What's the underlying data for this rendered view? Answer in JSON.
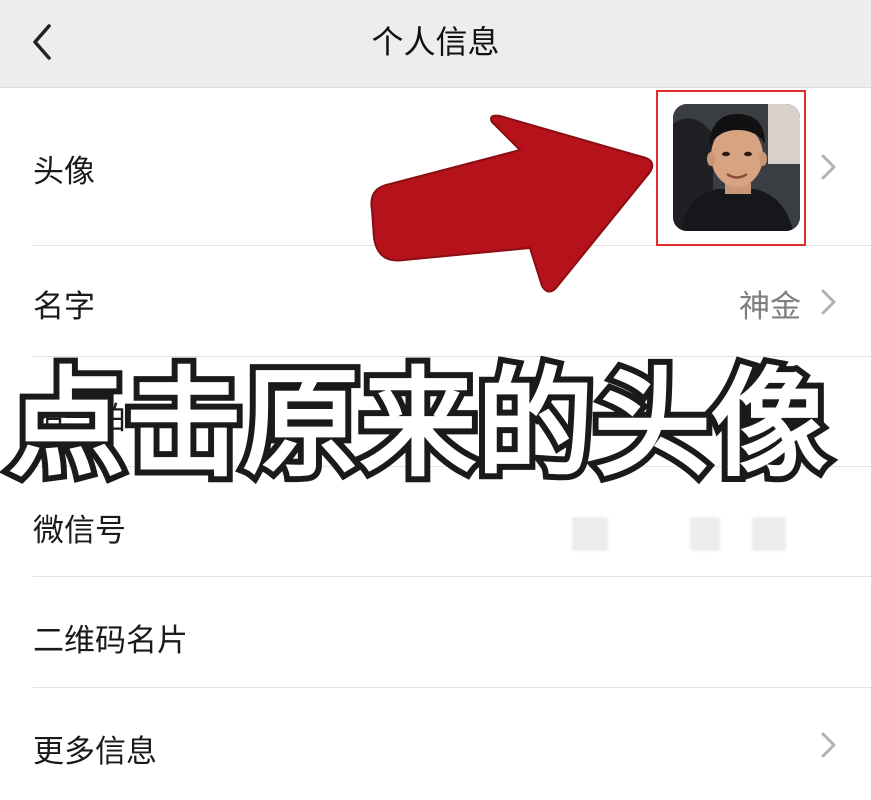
{
  "nav": {
    "title": "个人信息"
  },
  "rows": {
    "avatar_label": "头像",
    "name_label": "名字",
    "name_value": "神金",
    "pat_label": "拍一拍",
    "wechat_id_label": "微信号",
    "qr_label": "二维码名片",
    "more_label": "更多信息"
  },
  "overlay": {
    "caption": "点击原来的头像"
  },
  "colors": {
    "nav_bg": "#ededed",
    "arrow": "#b5121b",
    "highlight_box": "#e12d2d"
  },
  "icons": [
    "back-icon",
    "chevron-right-icon",
    "arrow-pointer-icon"
  ]
}
